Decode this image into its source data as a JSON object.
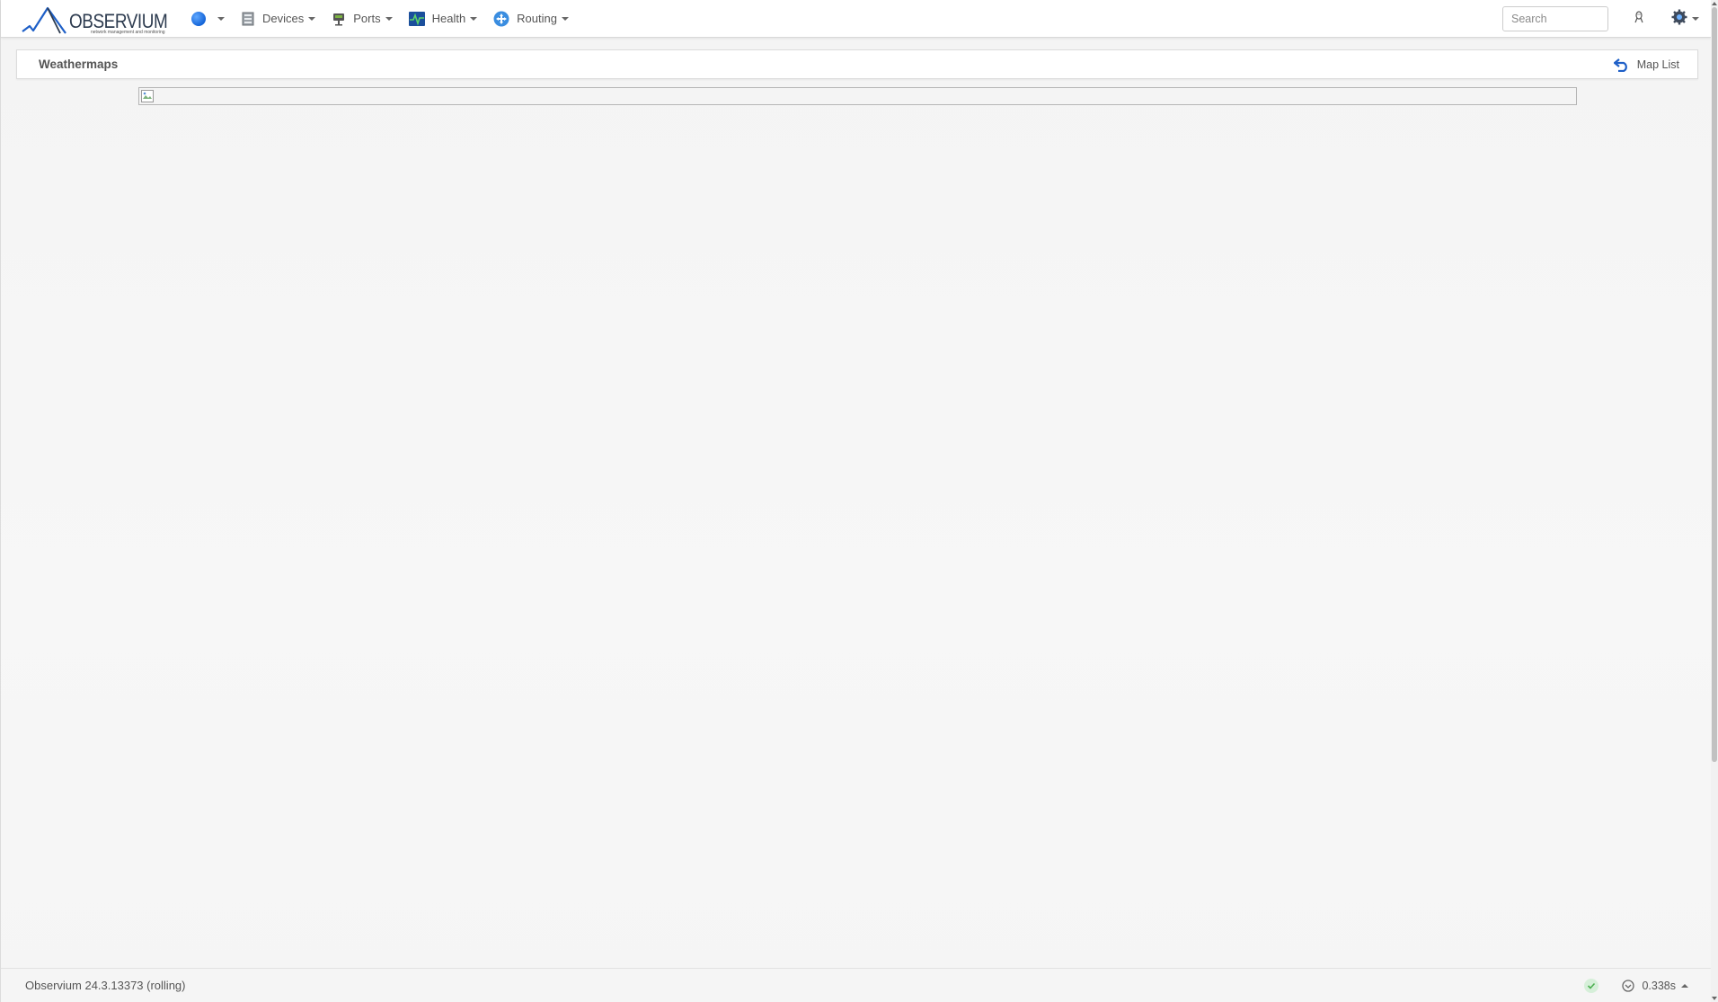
{
  "brand": {
    "name": "OBSERVIUM",
    "tagline": "network management and monitoring"
  },
  "navbar": {
    "items": [
      {
        "label": "",
        "icon": "globe-icon"
      },
      {
        "label": "Devices",
        "icon": "devices-icon"
      },
      {
        "label": "Ports",
        "icon": "ports-icon"
      },
      {
        "label": "Health",
        "icon": "health-icon"
      },
      {
        "label": "Routing",
        "icon": "routing-icon"
      }
    ],
    "search": {
      "placeholder": "Search",
      "value": ""
    },
    "icons": [
      "linux-icon",
      "gear-icon"
    ]
  },
  "page": {
    "title": "Weathermaps",
    "map_list_label": "Map List",
    "map_image": "broken-image-icon"
  },
  "footer": {
    "version": "Observium 24.3.13373 (rolling)",
    "timing": "0.338s"
  },
  "colors": {
    "accent": "#1e5fc7",
    "status_ok": "#4caf50"
  }
}
